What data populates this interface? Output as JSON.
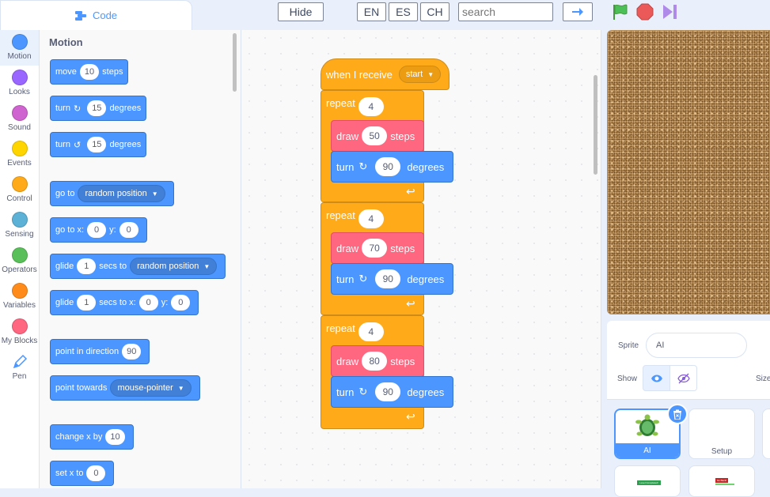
{
  "tabs": {
    "code": "Code"
  },
  "toolbar": {
    "hide": "Hide",
    "lang_en": "EN",
    "lang_es": "ES",
    "lang_ch": "CH",
    "search_placeholder": "search"
  },
  "categories": [
    {
      "label": "Motion",
      "color": "#4c97ff"
    },
    {
      "label": "Looks",
      "color": "#9966ff"
    },
    {
      "label": "Sound",
      "color": "#cf63cf"
    },
    {
      "label": "Events",
      "color": "#ffd500"
    },
    {
      "label": "Control",
      "color": "#ffab19"
    },
    {
      "label": "Sensing",
      "color": "#5cb1d6"
    },
    {
      "label": "Operators",
      "color": "#59c059"
    },
    {
      "label": "Variables",
      "color": "#ff8c1a"
    },
    {
      "label": "My Blocks",
      "color": "#ff6680"
    },
    {
      "label": "Pen",
      "color": "#0fbd8c"
    }
  ],
  "palette": {
    "title": "Motion",
    "move": {
      "a": "move",
      "v": "10",
      "b": "steps"
    },
    "turn_cw": {
      "a": "turn",
      "v": "15",
      "b": "degrees"
    },
    "turn_ccw": {
      "a": "turn",
      "v": "15",
      "b": "degrees"
    },
    "goto": {
      "a": "go to",
      "dd": "random position"
    },
    "gotoxy": {
      "a": "go to x:",
      "x": "0",
      "b": "y:",
      "y": "0"
    },
    "glide": {
      "a": "glide",
      "v": "1",
      "b": "secs to",
      "dd": "random position"
    },
    "glidexy": {
      "a": "glide",
      "v": "1",
      "b": "secs to x:",
      "x": "0",
      "c": "y:",
      "y": "0"
    },
    "pointdir": {
      "a": "point in direction",
      "v": "90"
    },
    "pointtowards": {
      "a": "point towards",
      "dd": "mouse-pointer"
    },
    "changex": {
      "a": "change x by",
      "v": "10"
    },
    "setx": {
      "a": "set x to",
      "v": "0"
    }
  },
  "script": {
    "hat": {
      "label": "when I receive",
      "dd": "start"
    },
    "loops": [
      {
        "label": "repeat",
        "count": "4",
        "draw": "draw",
        "steps_val": "50",
        "steps": "steps",
        "turn": "turn",
        "deg_val": "90",
        "deg": "degrees"
      },
      {
        "label": "repeat",
        "count": "4",
        "draw": "draw",
        "steps_val": "70",
        "steps": "steps",
        "turn": "turn",
        "deg_val": "90",
        "deg": "degrees"
      },
      {
        "label": "repeat",
        "count": "4",
        "draw": "draw",
        "steps_val": "80",
        "steps": "steps",
        "turn": "turn",
        "deg_val": "90",
        "deg": "degrees"
      }
    ]
  },
  "sprite_info": {
    "sprite_label": "Sprite",
    "sprite_name": "AI",
    "show_label": "Show",
    "size_label": "Size"
  },
  "sprites": [
    {
      "name": "AI"
    },
    {
      "name": "Setup"
    }
  ],
  "thumb_text": {
    "a": "Level Completed!",
    "b": "Go Back!"
  }
}
